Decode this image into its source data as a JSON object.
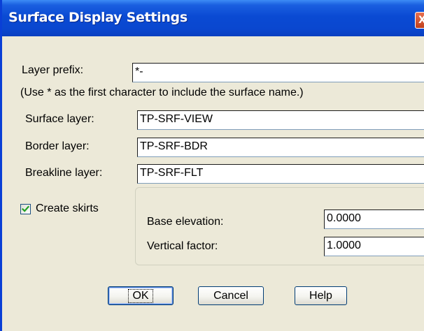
{
  "window": {
    "title": "Surface Display Settings",
    "close_glyph": "X"
  },
  "form": {
    "layer_prefix_label": "Layer prefix:",
    "layer_prefix_value": "*-",
    "hint": "(Use * as the first character to include the surface name.)",
    "surface_layer_label": "Surface layer:",
    "surface_layer_value": "TP-SRF-VIEW",
    "border_layer_label": "Border layer:",
    "border_layer_value": "TP-SRF-BDR",
    "breakline_layer_label": "Breakline layer:",
    "breakline_layer_value": "TP-SRF-FLT"
  },
  "skirts": {
    "checkbox_label": "Create skirts",
    "checked": true,
    "base_elevation_label": "Base elevation:",
    "base_elevation_value": "0.0000",
    "vertical_factor_label": "Vertical factor:",
    "vertical_factor_value": "1.0000"
  },
  "buttons": {
    "ok": "OK",
    "cancel": "Cancel",
    "help": "Help"
  },
  "colors": {
    "titlebar": "#0a47cf",
    "dialog_bg": "#ece9d8",
    "button_border": "#003c74",
    "close_button": "#d5532e",
    "checkmark": "#21a121"
  },
  "icons": {
    "close": "close-icon",
    "check": "checkmark-icon"
  }
}
